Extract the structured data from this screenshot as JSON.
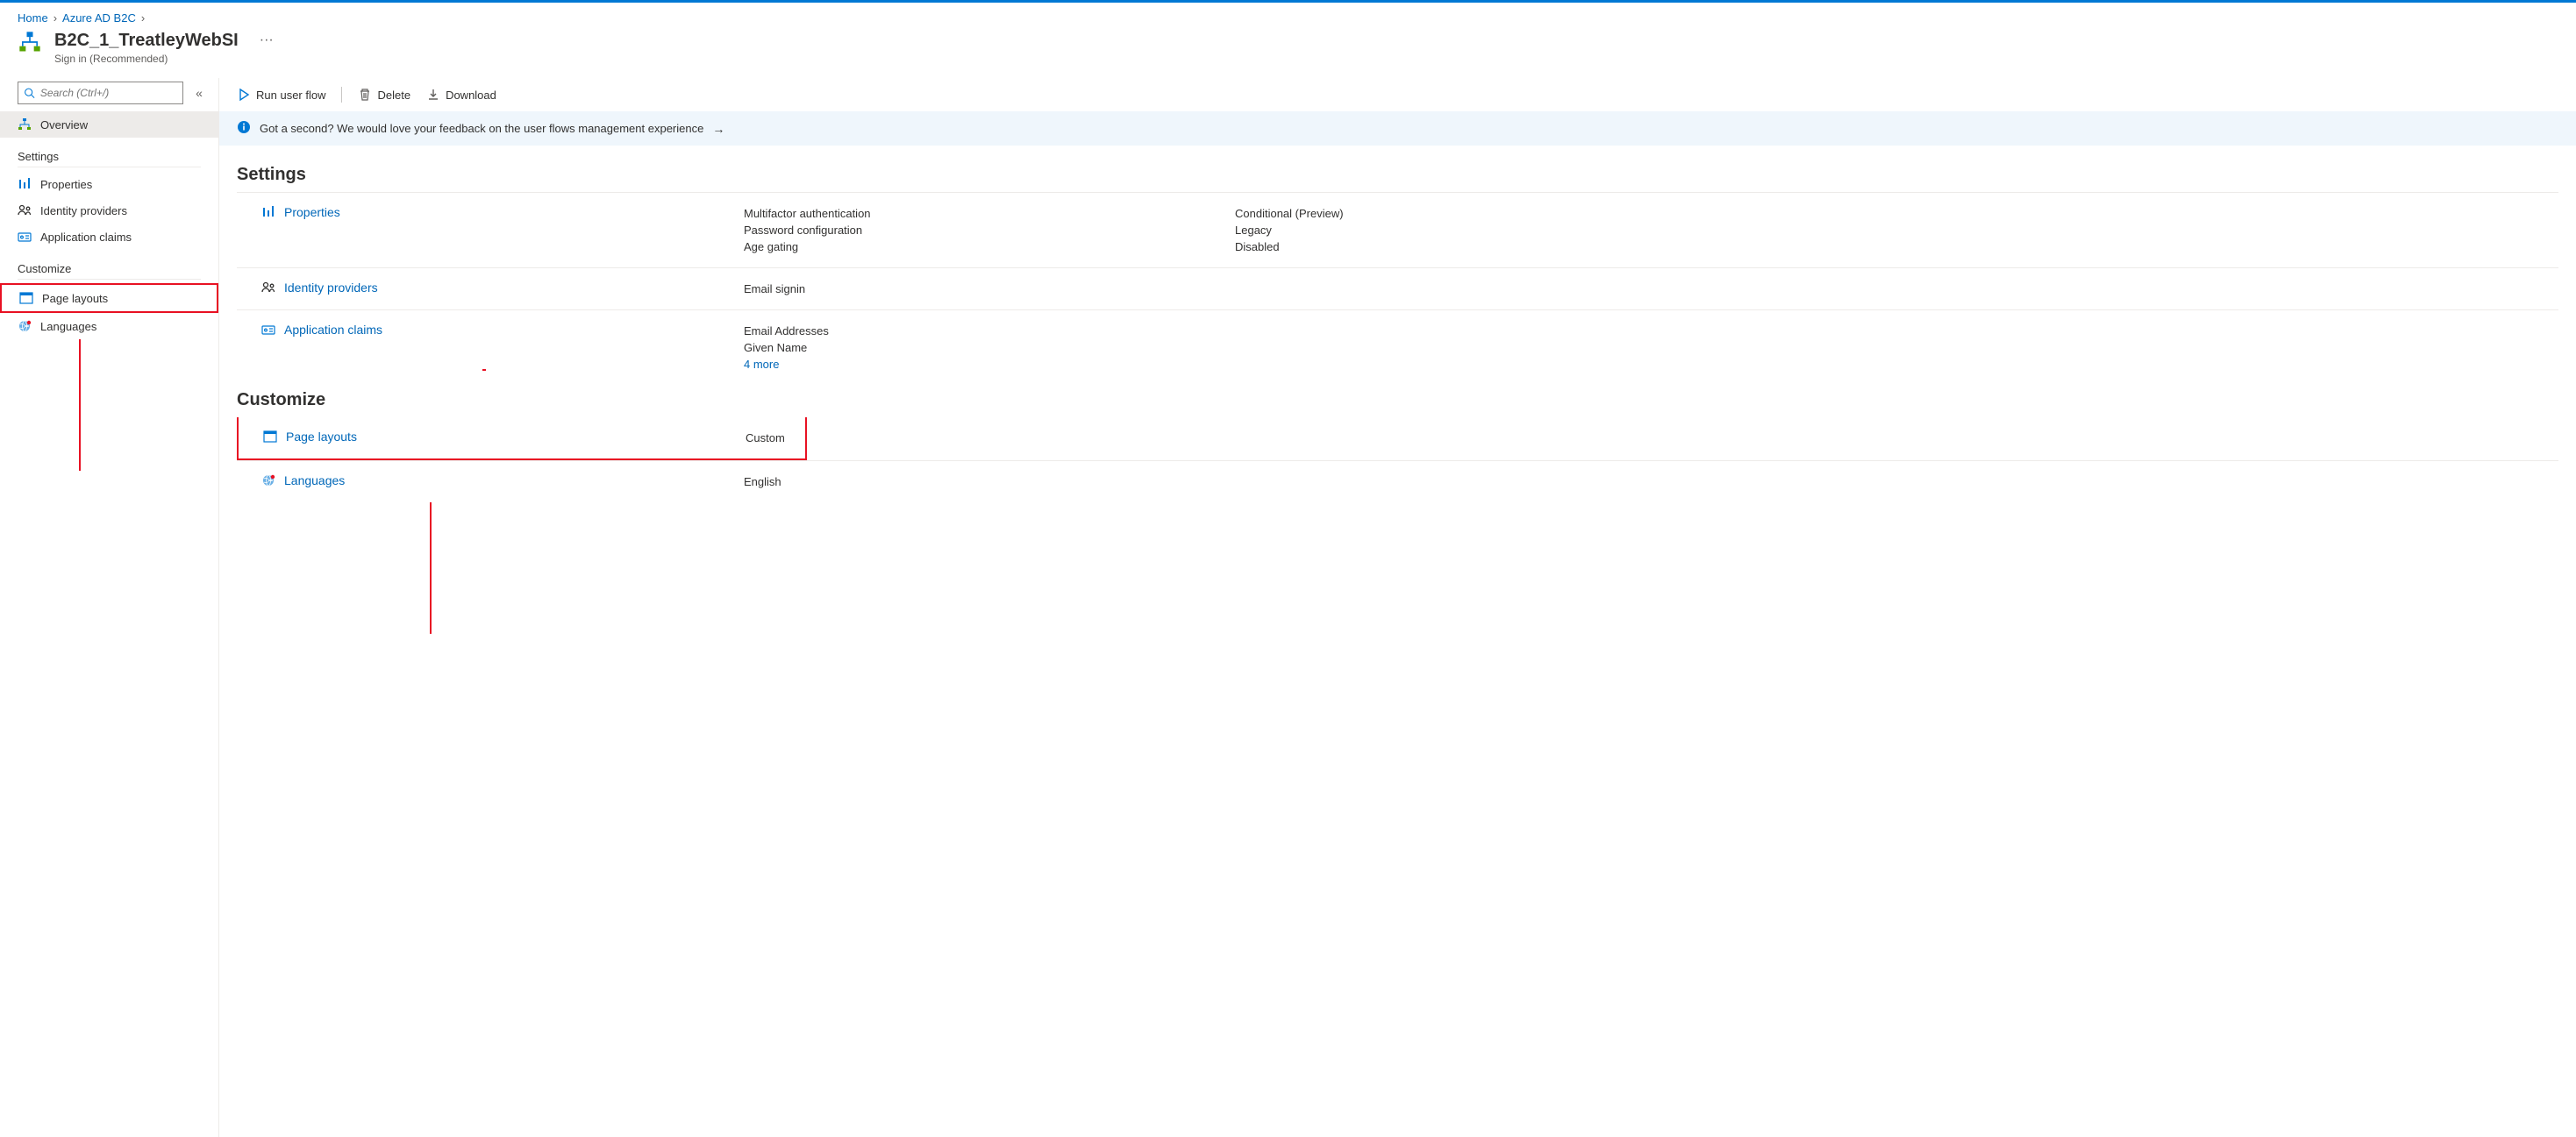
{
  "breadcrumb": {
    "home": "Home",
    "b2c": "Azure AD B2C"
  },
  "title": {
    "name": "B2C_1_TreatleyWebSI",
    "subtitle": "Sign in (Recommended)"
  },
  "search": {
    "placeholder": "Search (Ctrl+/)"
  },
  "sidebar": {
    "overview": "Overview",
    "group_settings": "Settings",
    "properties": "Properties",
    "identity_providers": "Identity providers",
    "application_claims": "Application claims",
    "group_customize": "Customize",
    "page_layouts": "Page layouts",
    "languages": "Languages"
  },
  "toolbar": {
    "run": "Run user flow",
    "delete": "Delete",
    "download": "Download"
  },
  "banner": "Got a second? We would love your feedback on the user flows management experience",
  "sections": {
    "settings": "Settings",
    "customize": "Customize"
  },
  "rows": {
    "properties": {
      "label": "Properties",
      "left": [
        "Multifactor authentication",
        "Password configuration",
        "Age gating"
      ],
      "right": [
        "Conditional (Preview)",
        "Legacy",
        "Disabled"
      ]
    },
    "identity_providers": {
      "label": "Identity providers",
      "left": [
        "Email signin"
      ]
    },
    "application_claims": {
      "label": "Application claims",
      "left": [
        "Email Addresses",
        "Given Name"
      ],
      "more": "4  more"
    },
    "page_layouts": {
      "label": "Page layouts",
      "left": [
        "Custom"
      ]
    },
    "languages": {
      "label": "Languages",
      "left": [
        "English"
      ]
    }
  }
}
